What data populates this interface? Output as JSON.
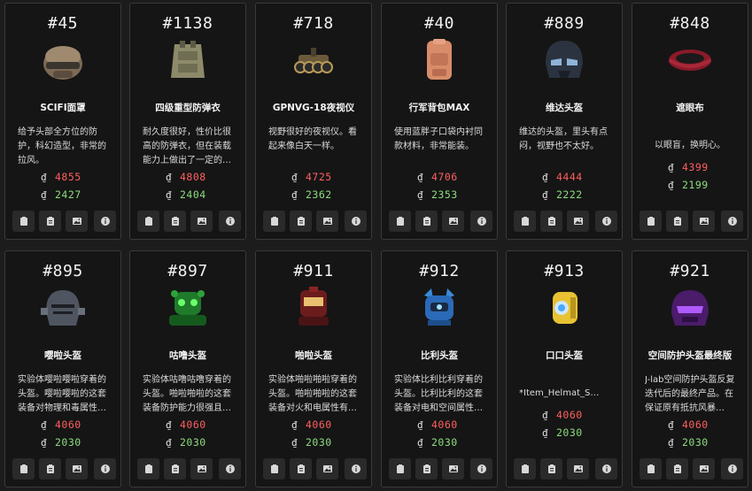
{
  "currency_symbol": "₫",
  "colors": {
    "price_red": "#ff5f5f",
    "price_green": "#8bdc7d",
    "card_bg": "#151515"
  },
  "action_icons": [
    "clipboard-icon",
    "clipboard-list-icon",
    "image-icon",
    "info-icon"
  ],
  "items": [
    {
      "id": "#45",
      "name": "SCIFI面罩",
      "description": "给予头部全方位的防护，科幻造型，非常的拉风。",
      "price_high": "4855",
      "price_low": "2427",
      "icon": "scifi-mask-icon"
    },
    {
      "id": "#1138",
      "name": "四级重型防弹衣",
      "description": "耐久度很好，性价比很高的防弹衣，但在装载能力上做出了一定的…",
      "price_high": "4808",
      "price_low": "2404",
      "icon": "heavy-vest-icon"
    },
    {
      "id": "#718",
      "name": "GPNVG-18夜视仪",
      "description": "视野很好的夜视仪。看起来像白天一样。",
      "price_high": "4725",
      "price_low": "2362",
      "icon": "night-vision-icon"
    },
    {
      "id": "#40",
      "name": "行军背包MAX",
      "description": "使用蓝胖子口袋内衬同款材料，非常能装。",
      "price_high": "4706",
      "price_low": "2353",
      "icon": "backpack-icon"
    },
    {
      "id": "#889",
      "name": "维达头盔",
      "description": "维达的头盔，里头有点闷，视野也不太好。",
      "price_high": "4444",
      "price_low": "2222",
      "icon": "vader-helmet-icon"
    },
    {
      "id": "#848",
      "name": "遮眼布",
      "description": "以眼盲，换明心。",
      "price_high": "4399",
      "price_low": "2199",
      "icon": "blindfold-icon"
    },
    {
      "id": "#895",
      "name": "嘤啦头盔",
      "description": "实验体嘤啦嘤啦穿着的头盔。嘤啦嘤啦的这套装备对物理和毒属性…",
      "price_high": "4060",
      "price_low": "2030",
      "icon": "knight-helmet-icon"
    },
    {
      "id": "#897",
      "name": "咕噜头盔",
      "description": "实验体咕噜咕噜穿着的头盔。啪啦啪啦的这套装备防护能力很强且…",
      "price_high": "4060",
      "price_low": "2030",
      "icon": "green-robot-icon"
    },
    {
      "id": "#911",
      "name": "啪啦头盔",
      "description": "实验体啪啦啪啦穿着的头盔。啪啦啪啦的这套装备对火和电属性有…",
      "price_high": "4060",
      "price_low": "2030",
      "icon": "red-robot-icon"
    },
    {
      "id": "#912",
      "name": "比利头盔",
      "description": "实验体比利比利穿着的头盔。比利比利的这套装备对电和空间属性…",
      "price_high": "4060",
      "price_low": "2030",
      "icon": "blue-robot-icon"
    },
    {
      "id": "#913",
      "name": "口口头盔",
      "description": "*Item_Helmat_S…",
      "price_high": "4060",
      "price_low": "2030",
      "icon": "yellow-helmet-icon"
    },
    {
      "id": "#921",
      "name": "空间防护头盔最终版",
      "description": "J-lab空间防护头盔反复迭代后的最终产品。在保证原有抵抗风暴…",
      "price_high": "4060",
      "price_low": "2030",
      "icon": "purple-helmet-icon"
    }
  ]
}
